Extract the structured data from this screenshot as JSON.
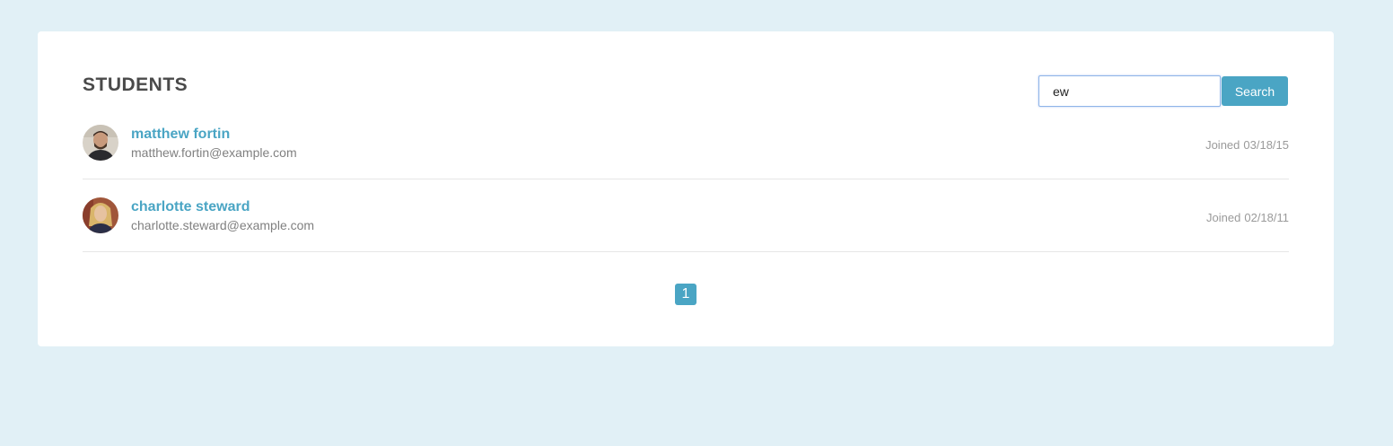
{
  "page": {
    "title": "STUDENTS"
  },
  "search": {
    "value": "ew",
    "button_label": "Search"
  },
  "students": [
    {
      "name": "matthew fortin",
      "email": "matthew.fortin@example.com",
      "joined_label": "Joined",
      "joined_date": "03/18/15",
      "avatar": "man-portrait-avatar"
    },
    {
      "name": "charlotte steward",
      "email": "charlotte.steward@example.com",
      "joined_label": "Joined",
      "joined_date": "02/18/11",
      "avatar": "woman-portrait-avatar"
    }
  ],
  "pagination": {
    "current_page": "1"
  },
  "colors": {
    "background": "#e1f0f6",
    "accent": "#4aa5c4",
    "title": "#4a4a4a"
  }
}
